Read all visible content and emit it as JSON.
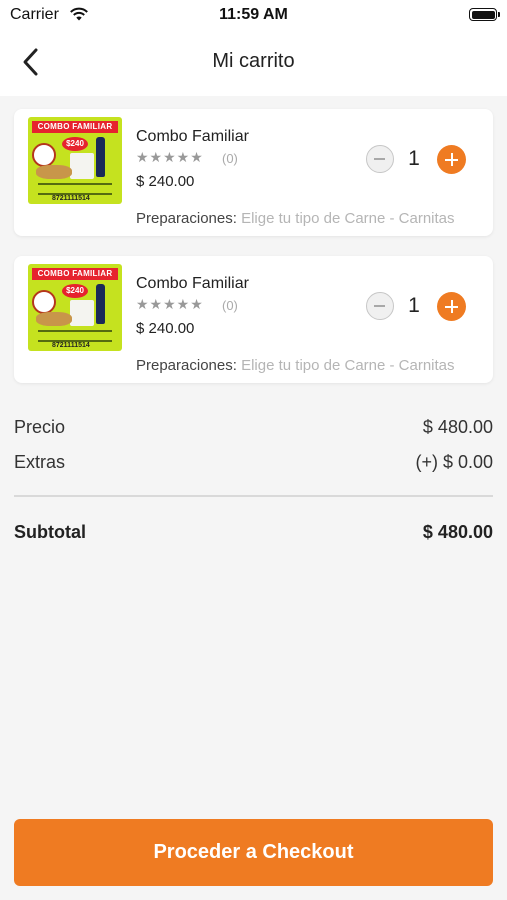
{
  "status_bar": {
    "carrier": "Carrier",
    "time": "11:59 AM"
  },
  "nav": {
    "title": "Mi carrito"
  },
  "cart_items": [
    {
      "name": "Combo Familiar",
      "stars": "★★★★★",
      "rating_count": "(0)",
      "price": "$ 240.00",
      "quantity": "1",
      "prep_label": "Preparaciones:",
      "prep_value": "Elige tu tipo de Carne - Carnitas",
      "image": {
        "banner": "COMBO FAMILIAR",
        "badge": "$240",
        "footer": "8721111514"
      }
    },
    {
      "name": "Combo Familiar",
      "stars": "★★★★★",
      "rating_count": "(0)",
      "price": "$ 240.00",
      "quantity": "1",
      "prep_label": "Preparaciones:",
      "prep_value": "Elige tu tipo de Carne - Carnitas",
      "image": {
        "banner": "COMBO FAMILIAR",
        "badge": "$240",
        "footer": "8721111514"
      }
    }
  ],
  "summary": {
    "price_label": "Precio",
    "price_value": "$ 480.00",
    "extras_label": "Extras",
    "extras_value": "(+) $ 0.00",
    "subtotal_label": "Subtotal",
    "subtotal_value": "$ 480.00"
  },
  "checkout": {
    "label": "Proceder a Checkout"
  },
  "colors": {
    "accent": "#ef7b22",
    "background": "#f5f5f5",
    "card": "#ffffff"
  }
}
